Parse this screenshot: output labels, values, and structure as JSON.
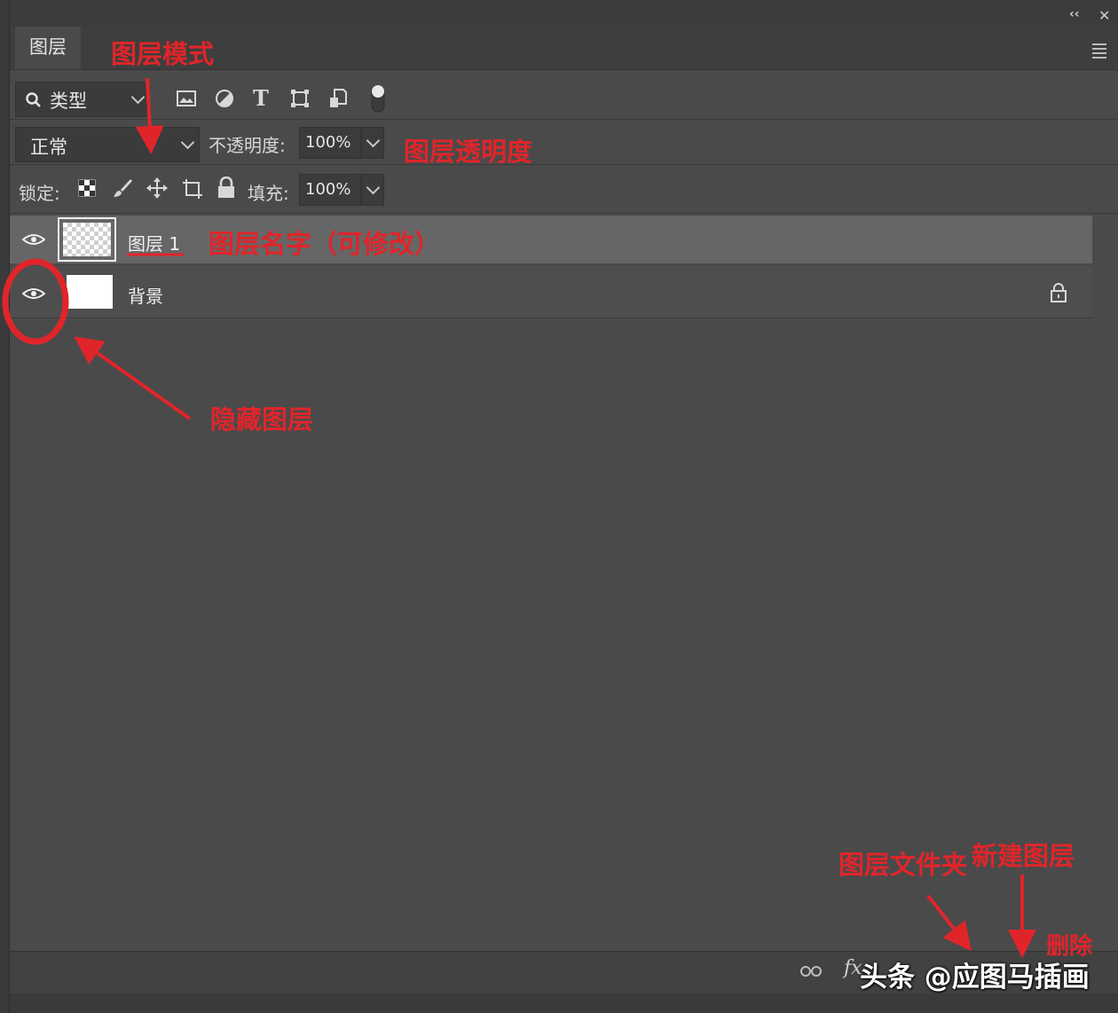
{
  "panel": {
    "tab_label": "图层",
    "collapse_icon": "double-chevron-left-icon",
    "close_icon": "close-icon",
    "menu_icon": "panel-menu-icon"
  },
  "filter": {
    "kind_label": "类型",
    "icons": [
      "image-filter-icon",
      "adjustment-filter-icon",
      "type-filter-icon",
      "shape-filter-icon",
      "smart-object-filter-icon",
      "filter-toggle-icon"
    ]
  },
  "blend": {
    "mode": "正常",
    "opacity_label": "不透明度:",
    "opacity_value": "100%"
  },
  "lock": {
    "label": "锁定:",
    "icons": [
      "lock-transparency-icon",
      "lock-pixels-icon",
      "lock-position-icon",
      "lock-artboard-icon",
      "lock-all-icon"
    ],
    "fill_label": "填充:",
    "fill_value": "100%"
  },
  "layers": [
    {
      "name": "图层 1",
      "selected": true,
      "thumbnail": "transparent"
    },
    {
      "name": "背景",
      "selected": false,
      "thumbnail": "white",
      "locked": true
    }
  ],
  "bottom": {
    "icons": [
      "link-layers-icon",
      "fx-icon"
    ],
    "fx_label": "fx"
  },
  "annotations": {
    "blend_mode": "图层模式",
    "opacity": "图层透明度",
    "layer_name": "图层名字（可修改）",
    "hide_layer": "隐藏图层",
    "group": "图层文件夹",
    "new_layer": "新建图层",
    "delete": "删除"
  },
  "watermark": "头条 @应图马插画",
  "colors": {
    "panel_bg": "#4a4a4a",
    "selected_row": "#666666",
    "annotation_red": "#e0252a"
  }
}
